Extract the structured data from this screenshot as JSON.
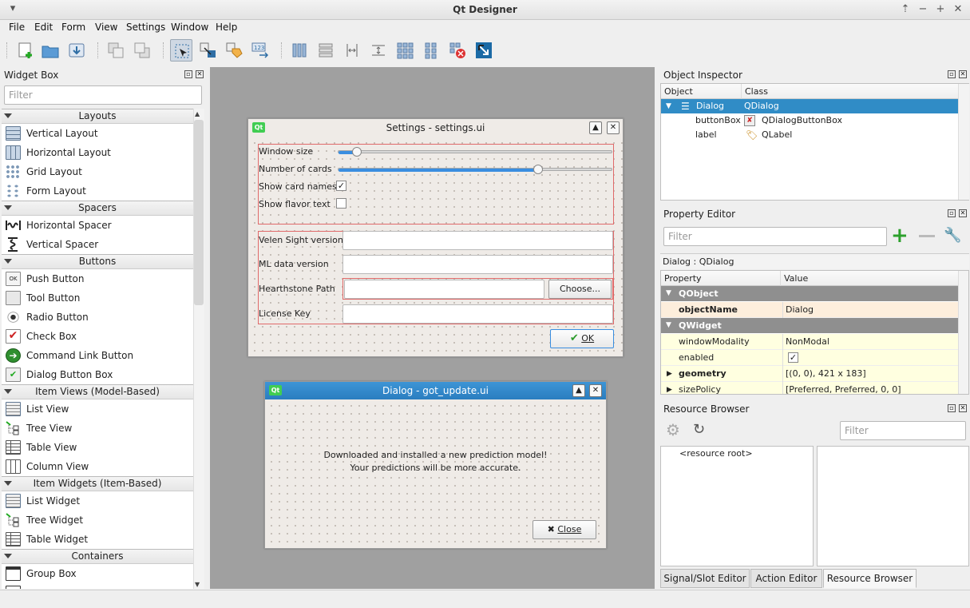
{
  "window": {
    "title": "Qt Designer"
  },
  "menu": [
    "File",
    "Edit",
    "Form",
    "View",
    "Settings",
    "Window",
    "Help"
  ],
  "widget_box": {
    "title": "Widget Box",
    "filter_placeholder": "Filter",
    "categories": [
      {
        "name": "Layouts",
        "items": [
          "Vertical Layout",
          "Horizontal Layout",
          "Grid Layout",
          "Form Layout"
        ]
      },
      {
        "name": "Spacers",
        "items": [
          "Horizontal Spacer",
          "Vertical Spacer"
        ]
      },
      {
        "name": "Buttons",
        "items": [
          "Push Button",
          "Tool Button",
          "Radio Button",
          "Check Box",
          "Command Link Button",
          "Dialog Button Box"
        ]
      },
      {
        "name": "Item Views (Model-Based)",
        "items": [
          "List View",
          "Tree View",
          "Table View",
          "Column View"
        ]
      },
      {
        "name": "Item Widgets (Item-Based)",
        "items": [
          "List Widget",
          "Tree Widget",
          "Table Widget"
        ]
      },
      {
        "name": "Containers",
        "items": [
          "Group Box"
        ]
      }
    ]
  },
  "settings_form": {
    "title": "Settings - settings.ui",
    "window_size_label": "Window size",
    "window_size_value": 0.07,
    "number_of_cards_label": "Number of cards",
    "number_of_cards_value": 0.73,
    "show_card_names_label": "Show card names",
    "show_card_names_checked": true,
    "show_flavor_text_label": "Show flavor text",
    "show_flavor_text_checked": false,
    "velen_label": "Velen Sight version",
    "ml_label": "ML data version",
    "hs_path_label": "Hearthstone Path",
    "choose_label": "Choose...",
    "license_label": "License Key",
    "ok_label": "OK"
  },
  "update_form": {
    "title": "Dialog - got_update.ui",
    "message_line1": "Downloaded and installed a new prediction model!",
    "message_line2": "Your predictions will be more accurate.",
    "close_label": "Close"
  },
  "object_inspector": {
    "title": "Object Inspector",
    "columns": [
      "Object",
      "Class"
    ],
    "rows": [
      {
        "object": "Dialog",
        "class": "QDialog"
      },
      {
        "object": "buttonBox",
        "class": "QDialogButtonBox"
      },
      {
        "object": "label",
        "class": "QLabel"
      }
    ]
  },
  "property_editor": {
    "title": "Property Editor",
    "filter_placeholder": "Filter",
    "context": "Dialog : QDialog",
    "columns": [
      "Property",
      "Value"
    ],
    "groups": [
      {
        "name": "QObject",
        "props": [
          {
            "key": "objectName",
            "value": "Dialog",
            "bold": true
          }
        ]
      },
      {
        "name": "QWidget",
        "props": [
          {
            "key": "windowModality",
            "value": "NonModal"
          },
          {
            "key": "enabled",
            "value": "✓"
          },
          {
            "key": "geometry",
            "value": "[(0, 0), 421 x 183]",
            "bold": true,
            "expand": true
          },
          {
            "key": "sizePolicy",
            "value": "[Preferred, Preferred, 0, 0]",
            "expand": true
          }
        ]
      }
    ]
  },
  "resource_browser": {
    "title": "Resource Browser",
    "filter_placeholder": "Filter",
    "root": "<resource root>"
  },
  "tabs": [
    "Signal/Slot Editor",
    "Action Editor",
    "Resource Browser"
  ],
  "colors": {
    "selection": "#308cc6",
    "accent_blue": "#3a8ee0",
    "layout_red": "#e06a6a"
  }
}
